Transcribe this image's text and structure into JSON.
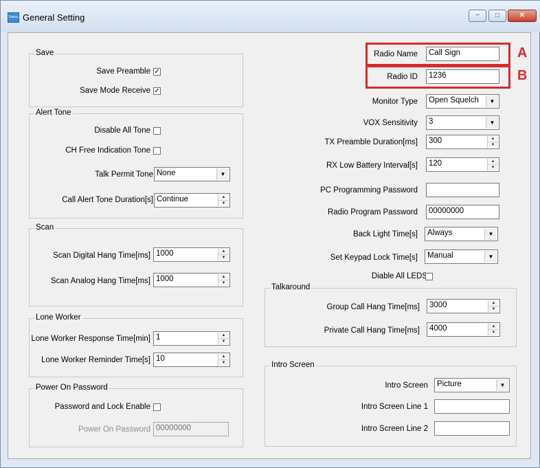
{
  "window": {
    "title": "General Setting",
    "app_icon_text": "Yaesu",
    "controls": {
      "minimize": "−",
      "maximize": "□",
      "close": "✕"
    }
  },
  "save": {
    "legend": "Save",
    "save_preamble_label": "Save Preamble",
    "save_preamble_checked": "✓",
    "save_mode_receive_label": "Save Mode Receive",
    "save_mode_receive_checked": "✓"
  },
  "alert_tone": {
    "legend": "Alert Tone",
    "disable_all_tone_label": "Disable All Tone",
    "ch_free_indication_tone_label": "CH Free Indication Tone",
    "talk_permit_tone_label": "Talk Permit Tone",
    "talk_permit_tone_value": "None",
    "call_alert_tone_duration_label": "Call Alert Tone Duration[s]",
    "call_alert_tone_duration_value": "Continue"
  },
  "scan": {
    "legend": "Scan",
    "digital_hang_time_label": "Scan Digital Hang Time[ms]",
    "digital_hang_time_value": "1000",
    "analog_hang_time_label": "Scan Analog Hang Time[ms]",
    "analog_hang_time_value": "1000"
  },
  "lone_worker": {
    "legend": "Lone Worker",
    "response_time_label": "Lone Worker Response Time[min]",
    "response_time_value": "1",
    "reminder_time_label": "Lone Worker Reminder Time[s]",
    "reminder_time_value": "10"
  },
  "power_on_password": {
    "legend": "Power On Password",
    "password_lock_enable_label": "Password and Lock Enable",
    "password_label": "Power On Password",
    "password_value": "00000000"
  },
  "radio": {
    "radio_name_label": "Radio Name",
    "radio_name_value": "Call Sign",
    "radio_id_label": "Radio ID",
    "radio_id_value": "1236",
    "monitor_type_label": "Monitor Type",
    "monitor_type_value": "Open Squelch",
    "vox_sensitivity_label": "VOX Sensitivity",
    "vox_sensitivity_value": "3",
    "tx_preamble_label": "TX Preamble Duration[ms]",
    "tx_preamble_value": "300",
    "rx_low_battery_label": "RX Low Battery Interval[s]",
    "rx_low_battery_value": "120",
    "pc_prog_password_label": "PC Programming Password",
    "pc_prog_password_value": "",
    "radio_prog_password_label": "Radio Program Password",
    "radio_prog_password_value": "00000000",
    "back_light_label": "Back Light Time[s]",
    "back_light_value": "Always",
    "keypad_lock_label": "Set Keypad Lock Time[s]",
    "keypad_lock_value": "Manual",
    "disable_leds_label": "Diable All LEDS"
  },
  "talkaround": {
    "legend": "Talkaround",
    "group_call_label": "Group Call Hang Time[ms]",
    "group_call_value": "3000",
    "private_call_label": "Private Call Hang Time[ms]",
    "private_call_value": "4000"
  },
  "intro_screen": {
    "legend": "Intro Screen",
    "intro_screen_label": "Intro Screen",
    "intro_screen_value": "Picture",
    "line1_label": "Intro Screen Line 1",
    "line1_value": "",
    "line2_label": "Intro Screen Line 2",
    "line2_value": ""
  },
  "annotations": {
    "a": "A",
    "b": "B",
    "color": "#d9292b"
  }
}
